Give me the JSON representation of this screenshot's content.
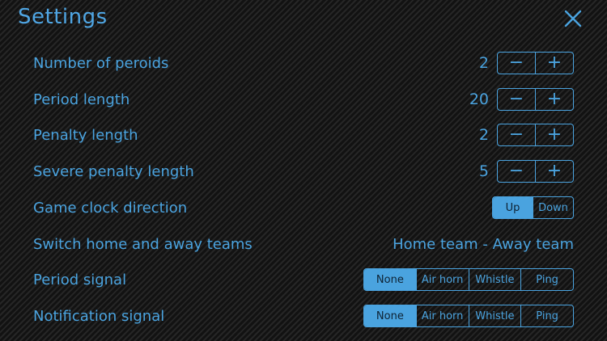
{
  "title": "Settings",
  "close_icon": "close-icon",
  "accent_color": "#4aa3df",
  "settings": {
    "periods": {
      "label": "Number of peroids",
      "value": "2",
      "minus": "−",
      "plus": "+"
    },
    "period_length": {
      "label": "Period length",
      "value": "20",
      "minus": "−",
      "plus": "+"
    },
    "penalty_length": {
      "label": "Penalty length",
      "value": "2",
      "minus": "−",
      "plus": "+"
    },
    "severe_penalty": {
      "label": "Severe penalty length",
      "value": "5",
      "minus": "−",
      "plus": "+"
    },
    "clock_direction": {
      "label": "Game clock direction",
      "options": [
        "Up",
        "Down"
      ],
      "selected": "Up"
    },
    "switch_teams": {
      "label": "Switch home and away teams",
      "value": "Home team - Away team"
    },
    "period_signal": {
      "label": "Period signal",
      "options": [
        "None",
        "Air horn",
        "Whistle",
        "Ping"
      ],
      "selected": "None"
    },
    "notification_signal": {
      "label": "Notification signal",
      "options": [
        "None",
        "Air horn",
        "Whistle",
        "Ping"
      ],
      "selected": "None"
    }
  }
}
